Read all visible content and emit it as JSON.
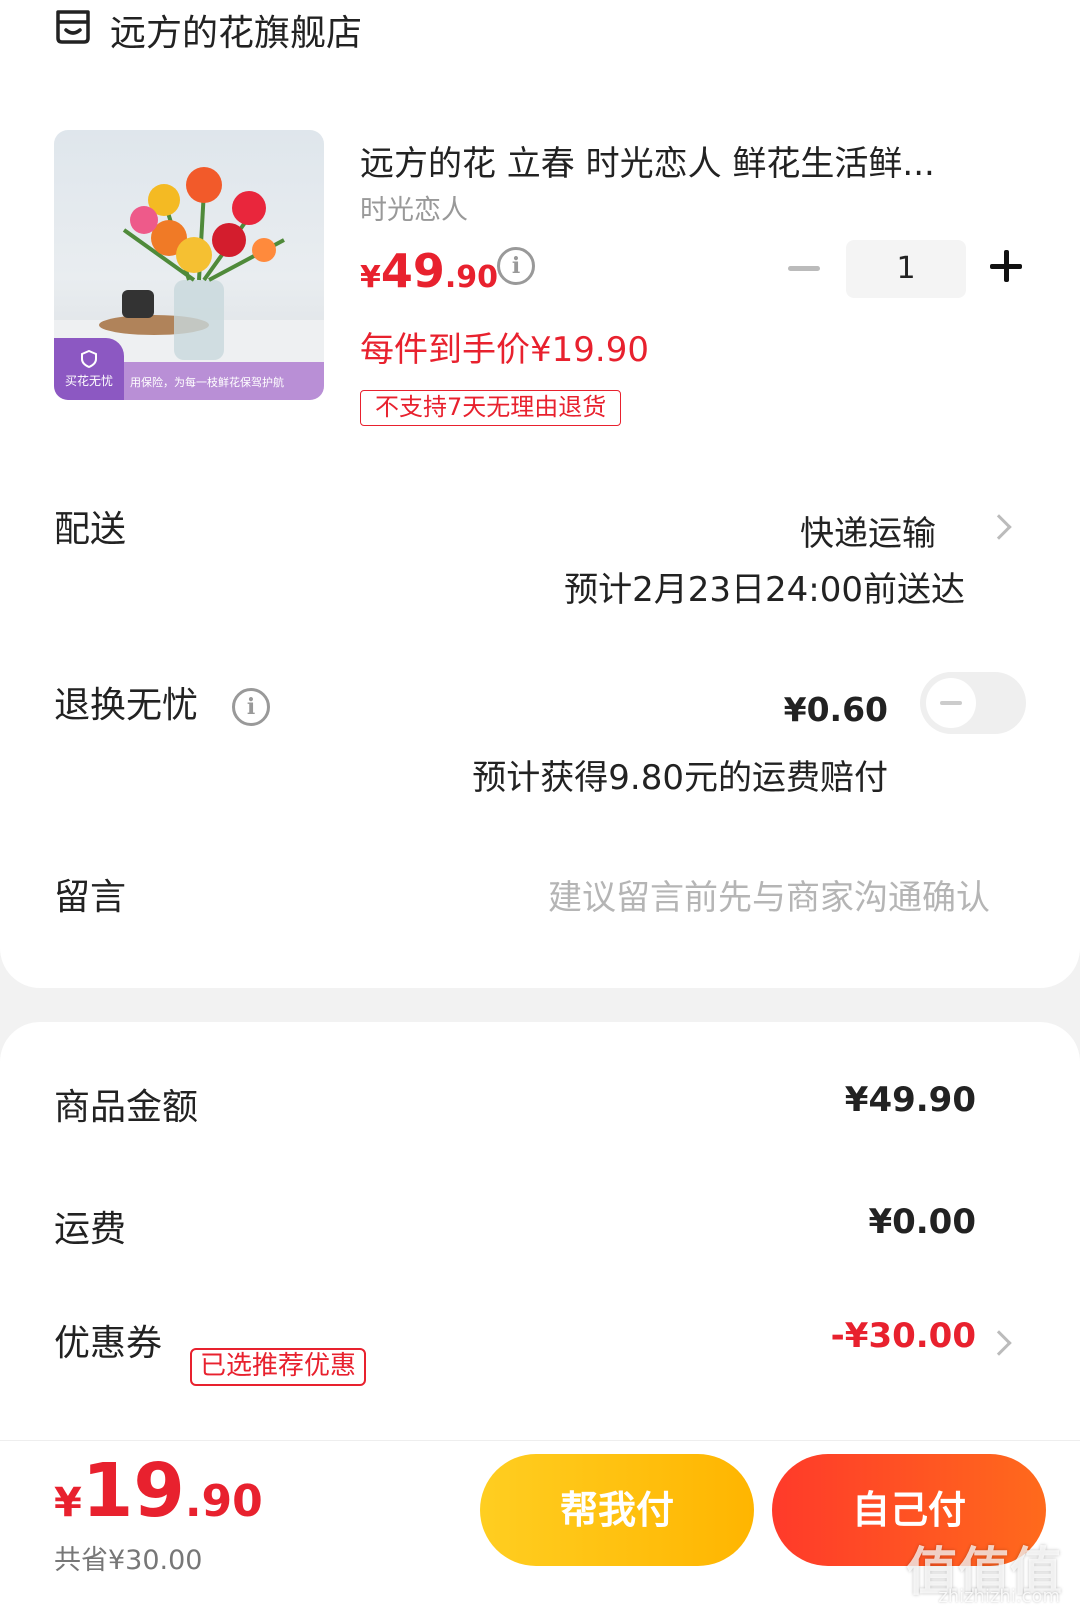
{
  "store": {
    "name": "远方的花旗舰店",
    "icon": "store-icon"
  },
  "product": {
    "title": "远方的花 立春 时光恋人 鲜花生活鲜...",
    "variant": "时光恋人",
    "price_symbol": "¥",
    "price_int": "49",
    "price_dec": ".90",
    "unit_price_label": "每件到手价¥19.90",
    "return_tag": "不支持7天无理由退货",
    "quantity": "1",
    "thumb_badge": "买花无忧",
    "thumb_banner": "用保险，为每一枝鲜花保驾护航"
  },
  "delivery": {
    "label": "配送",
    "method": "快递运输",
    "eta": "预计2月23日24:00前送达"
  },
  "return_insurance": {
    "label": "退换无忧",
    "price": "¥0.60",
    "compensation": "预计获得9.80元的运费赔付",
    "toggle_on": false
  },
  "message": {
    "label": "留言",
    "placeholder": "建议留言前先与商家沟通确认"
  },
  "summary": {
    "goods_label": "商品金额",
    "goods_amount": "¥49.90",
    "shipping_label": "运费",
    "shipping_amount": "¥0.00",
    "coupon_label": "优惠券",
    "coupon_tag": "已选推荐优惠",
    "coupon_amount": "-¥30.00"
  },
  "footer": {
    "total_symbol": "¥",
    "total_int": "19",
    "total_dec": ".90",
    "saved": "共省¥30.00",
    "help_pay": "帮我付",
    "self_pay": "自己付"
  },
  "watermark": {
    "main": "值值值",
    "sub": "zhizhizhi.com"
  },
  "colors": {
    "accent_red": "#e8212e",
    "help_yellow": "#ffc20e",
    "pay_red": "#ff4a24"
  }
}
